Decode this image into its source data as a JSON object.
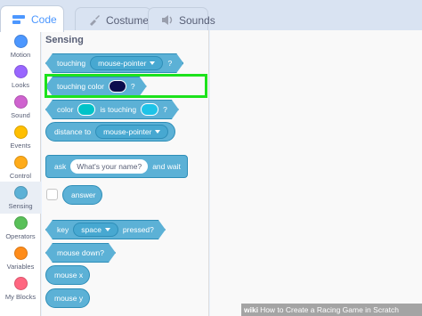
{
  "tabs": [
    {
      "label": "Code",
      "icon": "code-icon",
      "active": true
    },
    {
      "label": "Costumes",
      "icon": "brush-icon",
      "active": false
    },
    {
      "label": "Sounds",
      "icon": "speaker-icon",
      "active": false
    }
  ],
  "categories": [
    {
      "label": "Motion",
      "color": "#4c97ff"
    },
    {
      "label": "Looks",
      "color": "#9966ff"
    },
    {
      "label": "Sound",
      "color": "#cf63cf"
    },
    {
      "label": "Events",
      "color": "#ffbf00"
    },
    {
      "label": "Control",
      "color": "#ffab19"
    },
    {
      "label": "Sensing",
      "color": "#5cb1d6",
      "selected": true
    },
    {
      "label": "Operators",
      "color": "#59c059"
    },
    {
      "label": "Variables",
      "color": "#ff8c1a"
    },
    {
      "label": "My Blocks",
      "color": "#ff6680"
    }
  ],
  "palette": {
    "title": "Sensing",
    "blocks": {
      "touching": {
        "text": "touching",
        "dropdown": "mouse-pointer",
        "end": "?"
      },
      "touching_color": {
        "text": "touching color",
        "swatch": "#0b0d4d",
        "end": "?"
      },
      "color_touching": {
        "text1": "color",
        "swatch1": "#00c3c8",
        "text2": "is touching",
        "swatch2": "#1ec3e8",
        "end": "?"
      },
      "distance": {
        "text": "distance to",
        "dropdown": "mouse-pointer"
      },
      "ask": {
        "text": "ask",
        "input": "What's your name?",
        "end": "and wait"
      },
      "answer": {
        "text": "answer"
      },
      "key_pressed": {
        "text": "key",
        "dropdown": "space",
        "end": "pressed?"
      },
      "mouse_down": {
        "text": "mouse down?"
      },
      "mouse_x": {
        "text": "mouse x"
      },
      "mouse_y": {
        "text": "mouse y"
      }
    }
  },
  "watermark": {
    "brand": "wiki",
    "text": "How to Create a Racing Game in Scratch"
  }
}
